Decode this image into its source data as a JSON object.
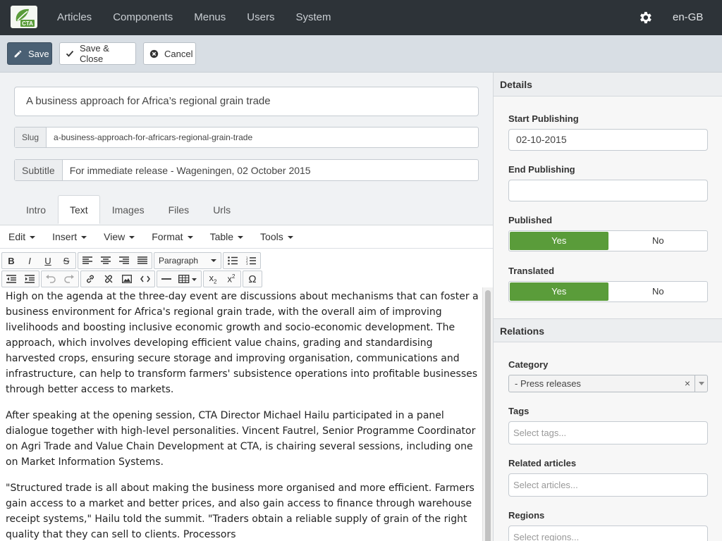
{
  "nav": {
    "items": [
      "Articles",
      "Components",
      "Menus",
      "Users",
      "System"
    ],
    "language": "en-GB",
    "logo_text": "CTA"
  },
  "toolbar": {
    "save_label": "Save",
    "save_close_label": "Save & Close",
    "cancel_label": "Cancel"
  },
  "article": {
    "title": "A business approach for Africa’s regional grain trade",
    "slug_label": "Slug",
    "slug": "a-business-approach-for-africars-regional-grain-trade",
    "subtitle_label": "Subtitle",
    "subtitle": "For immediate release - Wageningen, 02 October 2015"
  },
  "tabs": [
    "Intro",
    "Text",
    "Images",
    "Files",
    "Urls"
  ],
  "editor": {
    "menus": [
      "Edit",
      "Insert",
      "View",
      "Format",
      "Table",
      "Tools"
    ],
    "block_format": "Paragraph",
    "paragraphs": [
      "High on the agenda at the three-day event are discussions about mechanisms that can foster a business environment for Africa's regional grain trade, with the overall aim of improving livelihoods and boosting inclusive economic growth and socio-economic development. The approach, which involves developing efficient value chains, grading and standardising harvested crops, ensuring secure storage and improving organisation, communications and infrastructure, can help to transform farmers' subsistence operations into profitable businesses through better access to markets.",
      "After speaking at the opening session, CTA Director Michael Hailu participated in a panel dialogue together with high-level personalities. Vincent Fautrel, Senior Programme Coordinator on Agri Trade and Value Chain Development at CTA, is chairing several sessions, including one on Market Information Systems.",
      "\"Structured trade is all about making the business more organised and more efficient. Farmers gain access to a market and better prices, and also gain access to finance through warehouse receipt systems,\" Hailu told the summit. \"Traders obtain a reliable supply of grain of the right quality that they can sell to clients. Processors"
    ]
  },
  "sidebar": {
    "details_heading": "Details",
    "start_publishing_label": "Start Publishing",
    "start_publishing": "02-10-2015",
    "end_publishing_label": "End Publishing",
    "end_publishing": "",
    "published_label": "Published",
    "translated_label": "Translated",
    "yes": "Yes",
    "no": "No",
    "relations_heading": "Relations",
    "category_label": "Category",
    "category_value": "- Press releases",
    "tags_label": "Tags",
    "tags_placeholder": "Select tags...",
    "related_label": "Related articles",
    "related_placeholder": "Select articles...",
    "regions_label": "Regions",
    "regions_placeholder": "Select regions..."
  },
  "colors": {
    "navbar": "#2d3338",
    "toggle_on": "#5a9c3a",
    "save_button": "#4a6074"
  }
}
